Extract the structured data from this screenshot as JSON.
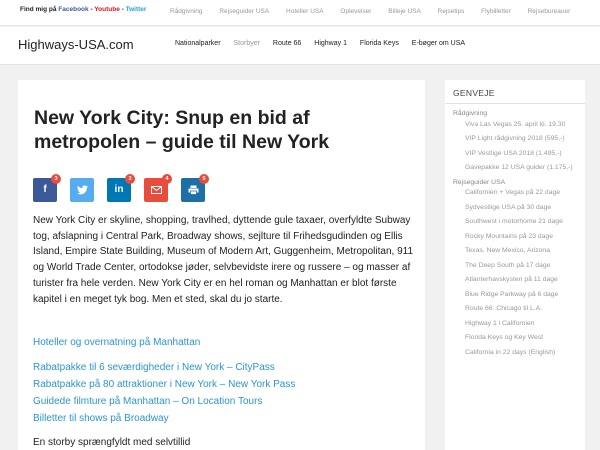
{
  "topbar": {
    "find_prefix": "Find mig på",
    "facebook": "Facebook",
    "youtube": "Youtube",
    "twitter": "Twitter",
    "sep1": " - ",
    "sep2": " - ",
    "nav": [
      "Rådgivning",
      "Rejseguider USA",
      "Hoteller USA",
      "Oplevelser",
      "Billeje USA",
      "Rejsetips",
      "Flybilletter",
      "Rejsebureauer"
    ]
  },
  "header": {
    "logo": "Highways-USA.com",
    "nav": [
      "Nationalparker",
      "Storbyer",
      "Route 66",
      "Highway 1",
      "Florida Keys",
      "E-bøger om USA"
    ]
  },
  "article": {
    "title": "New York City: Snup en bid af metropolen – guide til New York",
    "share_counts": [
      "3",
      "3",
      "4",
      "5"
    ],
    "body": "New York City er skyline, shopping, travlhed, dyttende gule taxaer, overfyldte Subway tog, afslapning i Central Park, Broadway shows, sejlture til Frihedsgudinden og Ellis Island, Empire State Building, Museum of Modern Art, Guggenheim, Metropolitan, 911 og World Trade Center, ortodokse jøder, selvbevidste irere og russere – og masser af turister fra hele verden. New York City er en hel roman og Manhattan er blot første kapitel i en meget tyk bog. Men et sted, skal du jo starte.",
    "links": [
      "Hoteller og overnatning på Manhattan",
      "Rabatpakke til 6 seværdigheder i New York – CityPass",
      "Rabatpakke på 80 attraktioner i New York – New York Pass",
      "Guidede filmture på Manhattan – On Location Tours",
      "Billetter til shows på Broadway"
    ],
    "subhead": "En storby sprængfyldt med selvtillid"
  },
  "sidebar": {
    "title": "GENVEJE",
    "cat1": "Rådgivning",
    "cat1_items": [
      "Viva Las Vegas 25. april kl. 19.30",
      "VIP Light rådgivning 2018 (595,-)",
      "VIP Vestlige USA 2018 (1.495,-)",
      "Gavepakke 12 USA guider (1.175,-)"
    ],
    "cat2": "Rejseguider USA",
    "cat2_items": [
      "Californien + Vegas på 22 dage",
      "Sydvestlige USA på 30 dage",
      "Southwest i motorhome 21 dage",
      "Rocky Mountains på 23 dage",
      "Texas, New Mexico, Arizona",
      "The Deep South på 17 dage",
      "Atlanterhavskysten på 11 dage",
      "Blue Ridge Parkway på 6 dage",
      "Route 66: Chicago til L.A.",
      "Highway 1 i Californien",
      "Florida Keys og Key West",
      "California in 22 days (English)"
    ]
  },
  "colors": {
    "facebook": "#3b5998",
    "twitter": "#55acee",
    "linkedin": "#0077b5",
    "email": "#e74c3c",
    "print": "#1d6fa5",
    "link": "#2a96cf"
  },
  "icons": [
    "facebook-icon",
    "twitter-icon",
    "linkedin-icon",
    "email-icon",
    "print-icon"
  ]
}
